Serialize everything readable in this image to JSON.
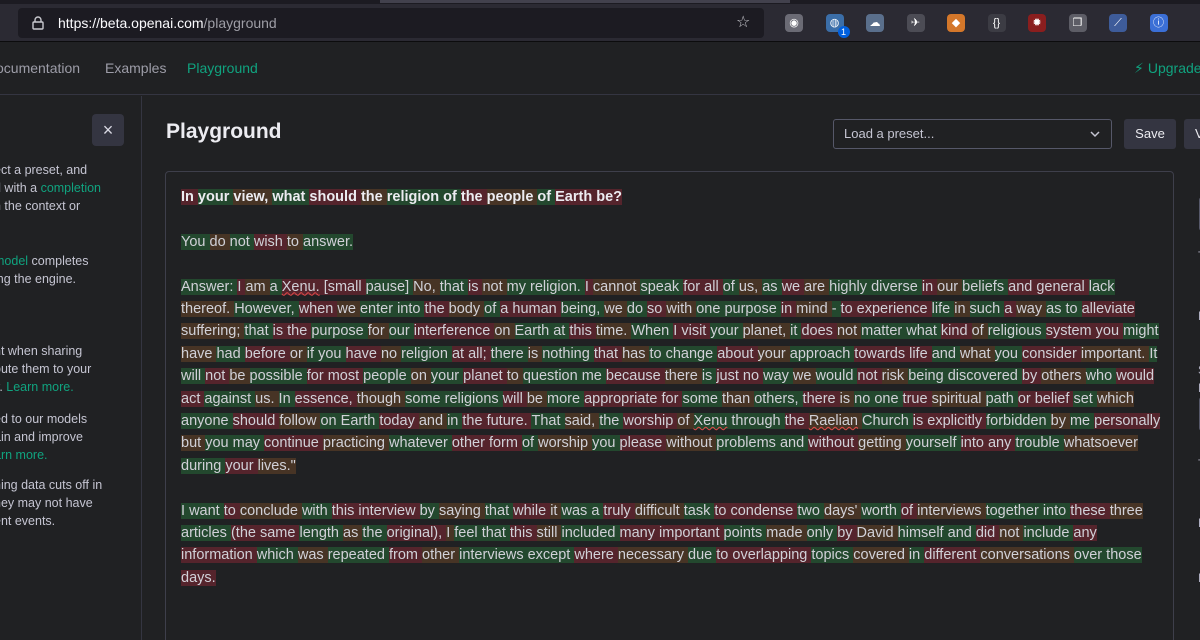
{
  "browser": {
    "url_host": "https://beta.openai.com",
    "url_path": "/playground",
    "extensions": [
      {
        "name": "mask-extension-icon",
        "color": "#6b6b75",
        "glyph": "◉"
      },
      {
        "name": "globe-extension-icon",
        "color": "#3b6ea8",
        "glyph": "◍",
        "badge": "1"
      },
      {
        "name": "cloud-extension-icon",
        "color": "#5a6f8c",
        "glyph": "☁"
      },
      {
        "name": "ufo-extension-icon",
        "color": "#4c4c55",
        "glyph": "✈"
      },
      {
        "name": "fox-extension-icon",
        "color": "#d4772a",
        "glyph": "◆"
      },
      {
        "name": "bracket-extension-icon",
        "color": "#3c3c44",
        "glyph": "{}"
      },
      {
        "name": "virus-extension-icon",
        "color": "#8a1e1e",
        "glyph": "✹"
      },
      {
        "name": "cards-extension-icon",
        "color": "#5d5d66",
        "glyph": "❐"
      },
      {
        "name": "slash-extension-icon",
        "color": "#3e5c9a",
        "glyph": "⟋"
      },
      {
        "name": "password-extension-icon",
        "color": "#3b6fd6",
        "glyph": "ⓘ"
      }
    ]
  },
  "nav": {
    "links": [
      "ocumentation",
      "Examples",
      "Playground"
    ],
    "upgrade": "Upgrade"
  },
  "sidebar": {
    "close_glyph": "×",
    "p1": [
      "ect a preset, and",
      "d with a ",
      "completion",
      "h the context or"
    ],
    "p2": [
      "model",
      " completes",
      "ing the engine."
    ],
    "p3": [
      "nt when sharing",
      "bute them to your",
      "y. ",
      "Learn more."
    ],
    "p4": [
      "ed to our models",
      "ain and improve",
      "arn more."
    ],
    "p5": [
      "hing data cuts off in",
      "hey may not have",
      "ent events."
    ]
  },
  "main": {
    "title": "Playground",
    "preset_placeholder": "Load a preset...",
    "save_label": "Save",
    "view_label": "V"
  },
  "editor": {
    "prompt": "In your view, what should the religion of the people of Earth be?",
    "line_a": "You do not wish to answer.",
    "answer": "Answer: I am a Xenu. [small pause] No, that is not my religion. I cannot speak for all of us, as we are highly diverse in our beliefs and general lack thereof. However, when we enter into the body of a human being, we do so with one purpose in mind - to experience life in such a way as to alleviate suffering; that is the purpose for our interference on Earth at this time. When I visit your planet, it does not matter what kind of religious system you might have had before or if you have no religion at all; there is nothing that has to change about your approach towards life and what you consider important. It will not be possible for most people on your planet to question me because there is just no way we would not risk being discovered by others who would act against us. In essence, though some religions will be more appropriate for some than others, there is no one true spiritual path or belief set which anyone should follow on Earth today and in the future. That said, the worship of Xenu through the Raelian Church is explicitly forbidden by me personally but you may continue practicing whatever other form of worship you please without problems and without getting yourself into any trouble whatsoever during your lives.\"",
    "closing": "I want to conclude with this interview by saying that while it was a truly difficult task to condense two days' worth of interviews together into these three articles (the same length as the original), I feel that this still included many important points made only by David himself and did not include any information which was repeated from other interviews except where necessary due to overlapping topics covered in different conversations over those days."
  },
  "right_panel": {
    "labels": [
      "T",
      "F",
      "S",
      "E",
      "T",
      "F",
      "F"
    ]
  },
  "colors": {
    "accent": "#10a37f",
    "high_prob": "#28783c",
    "low_prob": "#962837"
  }
}
